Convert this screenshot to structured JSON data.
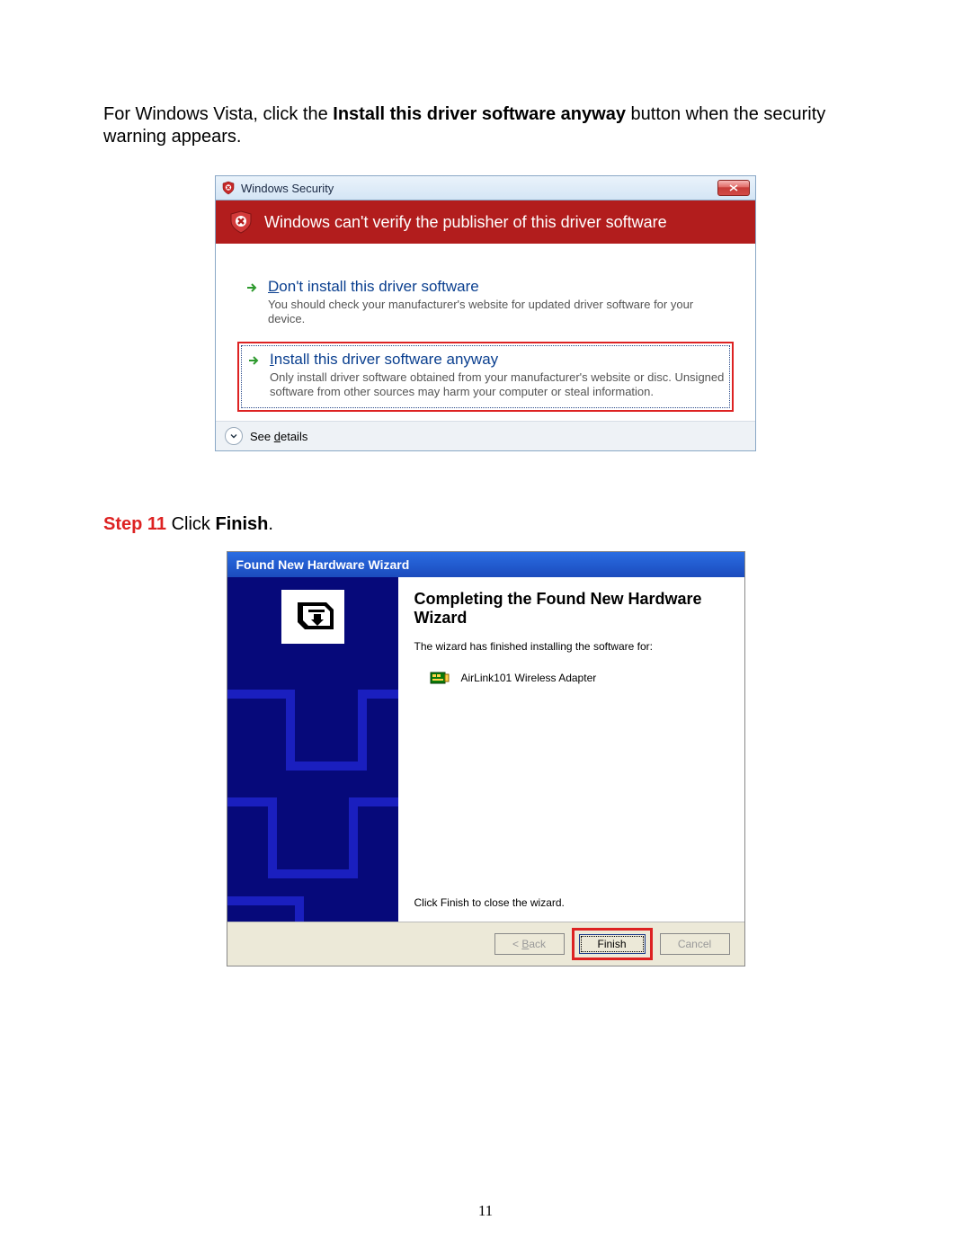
{
  "intro_pre": "For Windows Vista, click the ",
  "intro_bold": "Install this driver software anyway",
  "intro_post": " button when the security warning appears.",
  "vista": {
    "title": "Windows Security",
    "warn": "Windows can't verify the publisher of this driver software",
    "opt1_pre": "D",
    "opt1_rest": "on't install this driver software",
    "opt1_desc": "You should check your manufacturer's website for updated driver software for your device.",
    "opt2_pre": "I",
    "opt2_rest": "nstall this driver software anyway",
    "opt2_desc": "Only install driver software obtained from your manufacturer's website or disc. Unsigned software from other sources may harm your computer or steal information.",
    "details_pre": "See ",
    "details_u": "d",
    "details_post": "etails"
  },
  "step": {
    "label": "Step 11",
    "mid": " Click ",
    "bold": "Finish",
    "post": "."
  },
  "xp": {
    "title": "Found New Hardware Wizard",
    "heading": "Completing the Found New Hardware Wizard",
    "line1": "The wizard has finished installing the software for:",
    "device": "AirLink101 Wireless Adapter",
    "close": "Click Finish to close the wizard.",
    "back_pre": "< ",
    "back_u": "B",
    "back_post": "ack",
    "finish": "Finish",
    "cancel": "Cancel"
  },
  "page_number": "11"
}
